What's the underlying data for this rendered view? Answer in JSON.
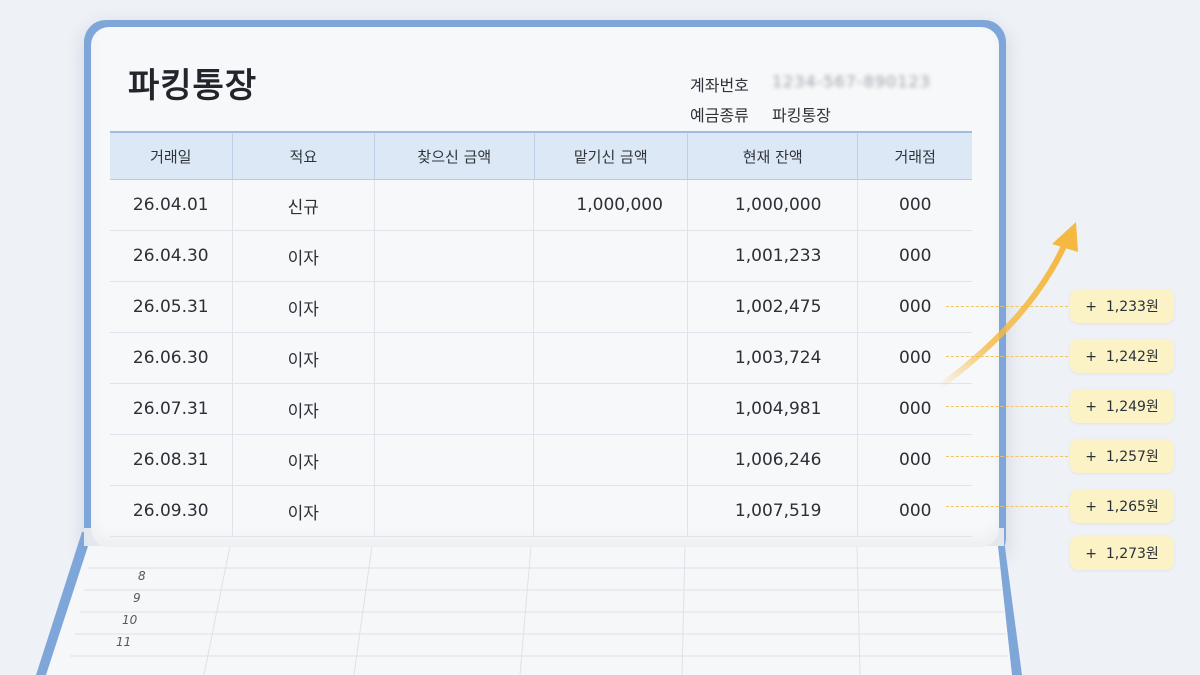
{
  "passbook": {
    "title": "파킹통장",
    "account_label": "계좌번호",
    "account_number": "1234-567-890123",
    "type_label": "예금종류",
    "type_value": "파킹통장"
  },
  "ledger": {
    "headers": [
      "거래일",
      "적요",
      "찾으신 금액",
      "맡기신 금액",
      "현재 잔액",
      "거래점"
    ],
    "rows": [
      {
        "date": "26.04.01",
        "desc": "신규",
        "withdrawal": "",
        "deposit": "1,000,000",
        "balance": "1,000,000",
        "branch": "000"
      },
      {
        "date": "26.04.30",
        "desc": "이자",
        "withdrawal": "",
        "deposit": "",
        "balance": "1,001,233",
        "branch": "000"
      },
      {
        "date": "26.05.31",
        "desc": "이자",
        "withdrawal": "",
        "deposit": "",
        "balance": "1,002,475",
        "branch": "000"
      },
      {
        "date": "26.06.30",
        "desc": "이자",
        "withdrawal": "",
        "deposit": "",
        "balance": "1,003,724",
        "branch": "000"
      },
      {
        "date": "26.07.31",
        "desc": "이자",
        "withdrawal": "",
        "deposit": "",
        "balance": "1,004,981",
        "branch": "000"
      },
      {
        "date": "26.08.31",
        "desc": "이자",
        "withdrawal": "",
        "deposit": "",
        "balance": "1,006,246",
        "branch": "000"
      },
      {
        "date": "26.09.30",
        "desc": "이자",
        "withdrawal": "",
        "deposit": "",
        "balance": "1,007,519",
        "branch": "000"
      }
    ]
  },
  "bottom_page": {
    "row_numbers": [
      "8",
      "9",
      "10",
      "11"
    ]
  },
  "interest_chips": [
    "+  1,233원",
    "+  1,242원",
    "+  1,249원",
    "+  1,257원",
    "+  1,265원",
    "+  1,273원"
  ],
  "colors": {
    "cover": "#7fa6d8",
    "header_fill": "#dde8f6",
    "chip_fill": "#fbf3c6",
    "arrow": "#f5b942"
  },
  "icons": {
    "growth_arrow": "arrow-up-right-icon"
  }
}
